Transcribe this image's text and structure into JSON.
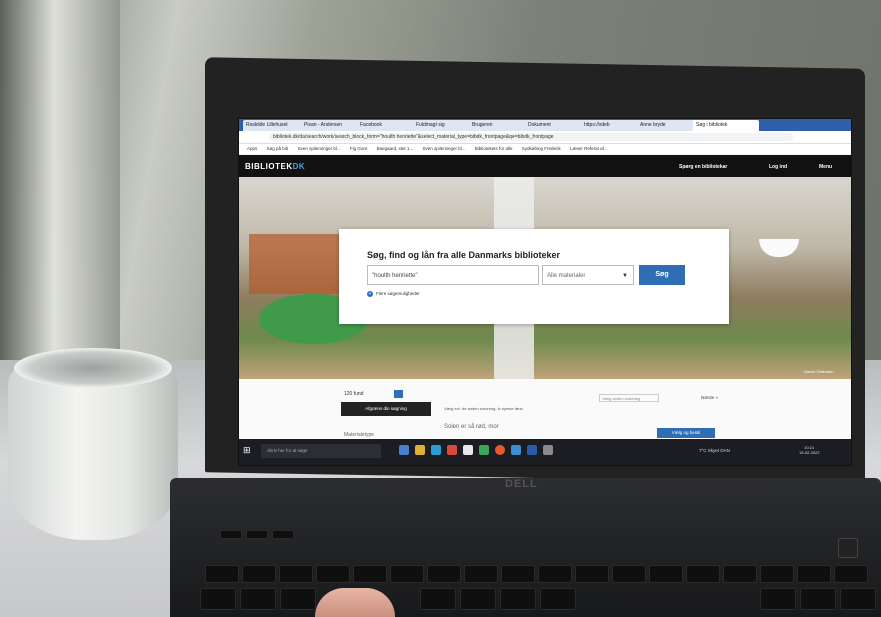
{
  "browser": {
    "tabs": [
      "Roskilde Lillehuset",
      "Pisan - Andersen",
      "Facebook",
      "Fuldmagt sig",
      "Brugeren",
      "Dokument",
      "https://siteb",
      "Anne bryde",
      "Søg i bibliotek"
    ],
    "url": "bibliotek.dk/da/search/work/search_block_form=\"houlth henriette\"&select_material_type=bibdk_frontpage&qe=bibdk_frontpage",
    "bookmarks": [
      "Apps",
      "Søg på bib",
      "Sven spilersinger bl...",
      "Fig Gore",
      "Baegaard, slet 1...",
      "Sven spilersinger bl...",
      "Bibliotekets for alle",
      "Sydkøbing Frederik",
      "Læser Referat af..."
    ]
  },
  "site": {
    "logo_main": "BIBLIOTEK",
    "logo_suffix": "DK",
    "ask_librarian": "Spørg en bibliotekar",
    "login": "Log ind",
    "menu": "Menu",
    "search_title": "Søg, find og lån fra alle Danmarks biblioteker",
    "search_value": "\"houlth henriette\"",
    "material_select": "Alle materialer",
    "search_button": "Søg",
    "advanced": "Flere søgemuligheder",
    "photo_credit": "Daniel Östensen"
  },
  "results": {
    "count": "120 fund",
    "refine": "Afgræns din søgning",
    "hint": "Vælg evt. de anden sortering, fx nyeste først",
    "sort": "Vælg anden sortering",
    "next": "Næste »",
    "first_title": "Solen er så rød, mor",
    "materialetype": "Materialetype",
    "choose_action": "Vælg og bestil"
  },
  "taskbar": {
    "search": "Skriv her for at søge",
    "weather": "7°C Skyet",
    "lang": "DAN",
    "time": "10:21",
    "date": "15-02-2022"
  },
  "laptop": {
    "brand": "DELL"
  },
  "colors": {
    "accent": "#2f6db5",
    "header": "#111111"
  }
}
